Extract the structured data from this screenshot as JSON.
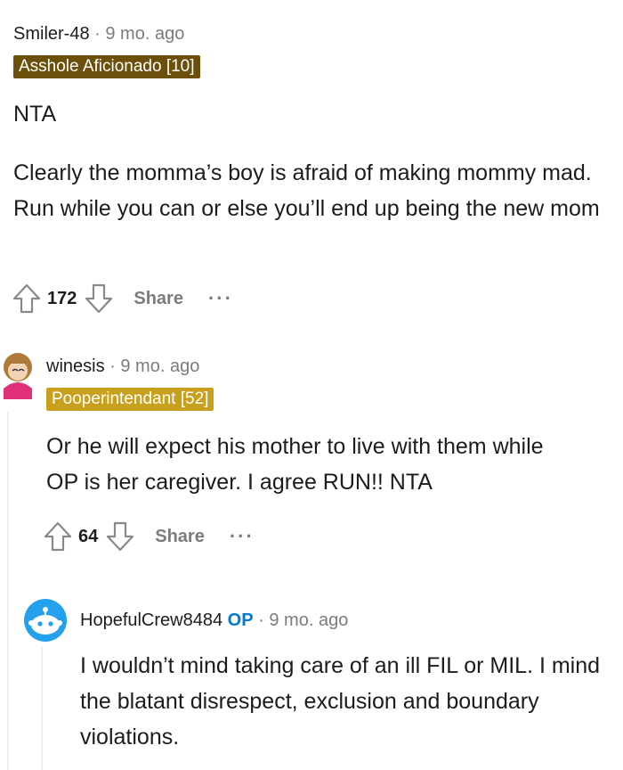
{
  "comments": [
    {
      "username": "Smiler-48",
      "separator": "·",
      "time": "9 mo. ago",
      "flair": "Asshole Aficionado [10]",
      "flair_color": "#6b4f0b",
      "paragraphs": [
        "NTA",
        "Clearly the momma’s boy is afraid of making mommy mad. Run while you can or else you’ll end up being the new mom"
      ],
      "votes": "172",
      "share_label": "Share",
      "more_label": "···"
    },
    {
      "username": "winesis",
      "separator": "·",
      "time": "9 mo. ago",
      "flair": "Pooperintendant [52]",
      "flair_color": "#c9a01c",
      "paragraphs": [
        "Or he will expect his mother to live with them while OP is her caregiver. I agree RUN!! NTA"
      ],
      "votes": "64",
      "share_label": "Share",
      "more_label": "···"
    },
    {
      "username": "HopefulCrew8484",
      "op_label": "OP",
      "separator": "·",
      "time": "9 mo. ago",
      "paragraphs": [
        "I wouldn’t mind taking care of an ill FIL or MIL. I mind the blatant disrespect, exclusion and boundary violations."
      ]
    }
  ],
  "colors": {
    "meta_gray": "#7c7c7c",
    "op_blue": "#0079d3",
    "thread_line": "#edeff1"
  }
}
